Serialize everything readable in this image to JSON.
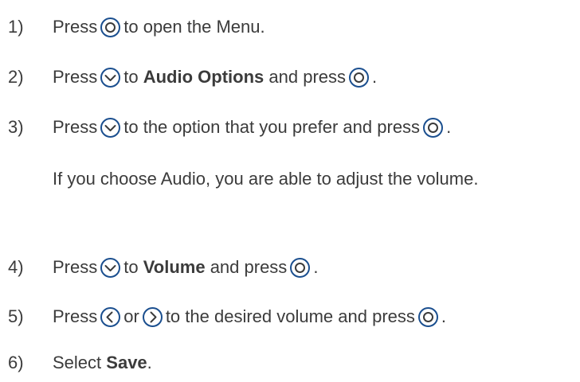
{
  "colors": {
    "text": "#3b3b3b",
    "button_outline": "#1b4f8f"
  },
  "icons": {
    "ok": "ok-button-icon",
    "down": "down-button-icon",
    "left": "left-button-icon",
    "right": "right-button-icon"
  },
  "steps": [
    {
      "number": "1)",
      "parts": [
        "Press",
        "to open the Menu."
      ]
    },
    {
      "number": "2)",
      "parts": [
        "Press",
        "to",
        "Audio Options",
        "and press",
        "."
      ]
    },
    {
      "number": "3)",
      "parts": [
        "Press",
        "to the option that you prefer and press",
        "."
      ]
    },
    {
      "number": "4)",
      "parts": [
        "Press",
        "to",
        "Volume",
        "and press",
        "."
      ]
    },
    {
      "number": "5)",
      "parts": [
        "Press",
        "or",
        "to the desired volume and press",
        "."
      ]
    },
    {
      "number": "6)",
      "parts": [
        "Select",
        "Save",
        "."
      ]
    }
  ],
  "note": "If you choose Audio, you are able to adjust the volume."
}
